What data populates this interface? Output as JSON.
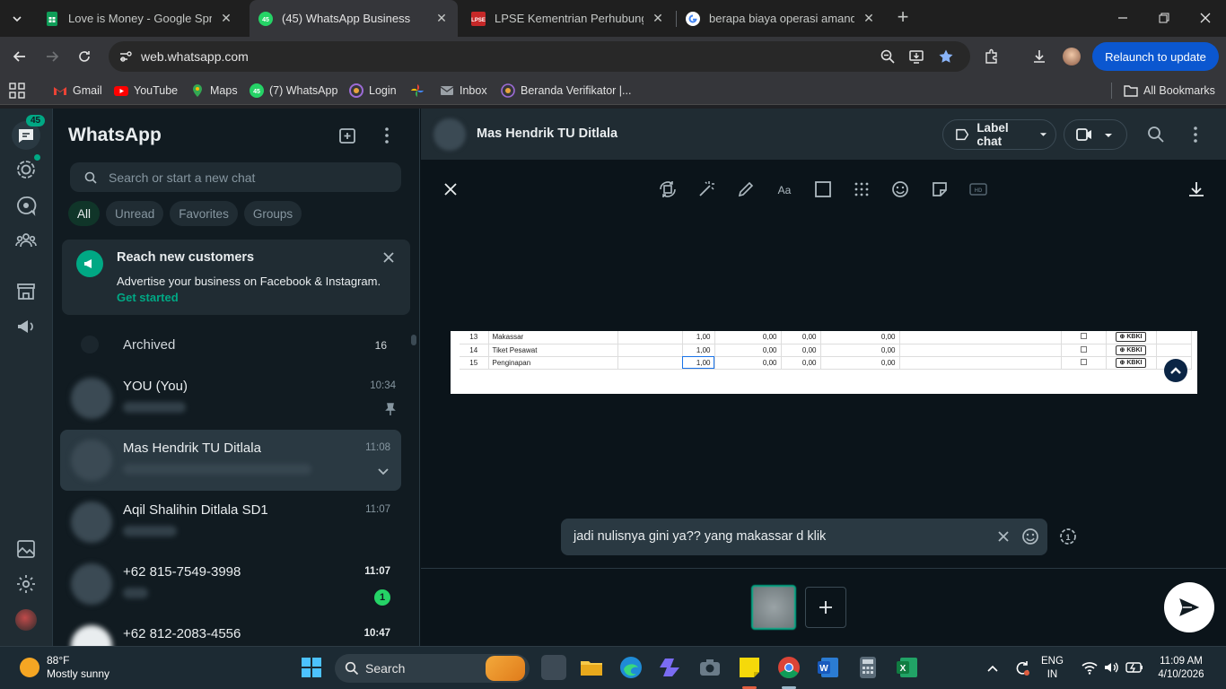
{
  "browser": {
    "tabs": [
      {
        "title": "Love is Money - Google Spread",
        "icon": "sheets-icon",
        "active": false
      },
      {
        "title": "(45) WhatsApp Business",
        "icon": "whatsapp-business-icon",
        "active": true
      },
      {
        "title": "LPSE Kementrian Perhubungan",
        "icon": "lpse-icon",
        "active": false
      },
      {
        "title": "berapa biaya operasi amandel -",
        "icon": "google-icon",
        "active": false
      }
    ],
    "url": "web.whatsapp.com",
    "relaunch_label": "Relaunch to update",
    "bookmarks": [
      {
        "label": "Gmail",
        "icon": "gmail-icon"
      },
      {
        "label": "YouTube",
        "icon": "youtube-icon"
      },
      {
        "label": "Maps",
        "icon": "maps-icon"
      },
      {
        "label": "(7) WhatsApp",
        "icon": "whatsapp-icon"
      },
      {
        "label": "Login",
        "icon": "login-icon"
      },
      {
        "label": "",
        "icon": "photos-icon"
      },
      {
        "label": "Inbox",
        "icon": "mail-icon"
      },
      {
        "label": "Beranda Verifikator |...",
        "icon": "globe-icon"
      }
    ],
    "all_bookmarks_label": "All Bookmarks"
  },
  "rail": {
    "chats_badge": "45"
  },
  "sidebar": {
    "title": "WhatsApp",
    "search_placeholder": "Search or start a new chat",
    "filters": [
      "All",
      "Unread",
      "Favorites",
      "Groups"
    ],
    "promo": {
      "title": "Reach new customers",
      "subtitle": "Advertise your business on Facebook & Instagram.",
      "link": "Get started"
    },
    "archived": {
      "label": "Archived",
      "count": "16"
    },
    "chats": [
      {
        "name": "YOU (You)",
        "time": "10:34",
        "pinned": true
      },
      {
        "name": "Mas Hendrik TU Ditlala",
        "time": "11:08",
        "selected": true
      },
      {
        "name": "Aqil Shalihin Ditlala SD1",
        "time": "11:07"
      },
      {
        "name": "+62 815-7549-3998",
        "time": "11:07",
        "unread": "1"
      },
      {
        "name": "+62 812-2083-4556",
        "time": "10:47"
      }
    ]
  },
  "main": {
    "contact_name": "Mas Hendrik TU Ditlala",
    "label_chat": "Label chat",
    "preview_rows": [
      {
        "no": "13",
        "item": "Makassar",
        "qty": "1,00",
        "a": "0,00",
        "b": "0,00",
        "c": "0,00",
        "btn": "KBKI"
      },
      {
        "no": "14",
        "item": "Tiket Pesawat",
        "qty": "1,00",
        "a": "0,00",
        "b": "0,00",
        "c": "0,00",
        "btn": "KBKI"
      },
      {
        "no": "15",
        "item": "Penginapan",
        "qty": "1,00",
        "a": "0,00",
        "b": "0,00",
        "c": "0,00",
        "btn": "KBKI"
      }
    ],
    "caption": "jadi nulisnya gini ya?? yang makassar d klik"
  },
  "taskbar": {
    "weather_temp": "88°F",
    "weather_desc": "Mostly sunny",
    "search_label": "Search",
    "lang": "ENG",
    "region": "IN",
    "time": "11:09 AM",
    "date": "4/10/2026"
  },
  "colors": {
    "accent": "#00a884",
    "panel": "#202c33",
    "background": "#0b141a"
  }
}
